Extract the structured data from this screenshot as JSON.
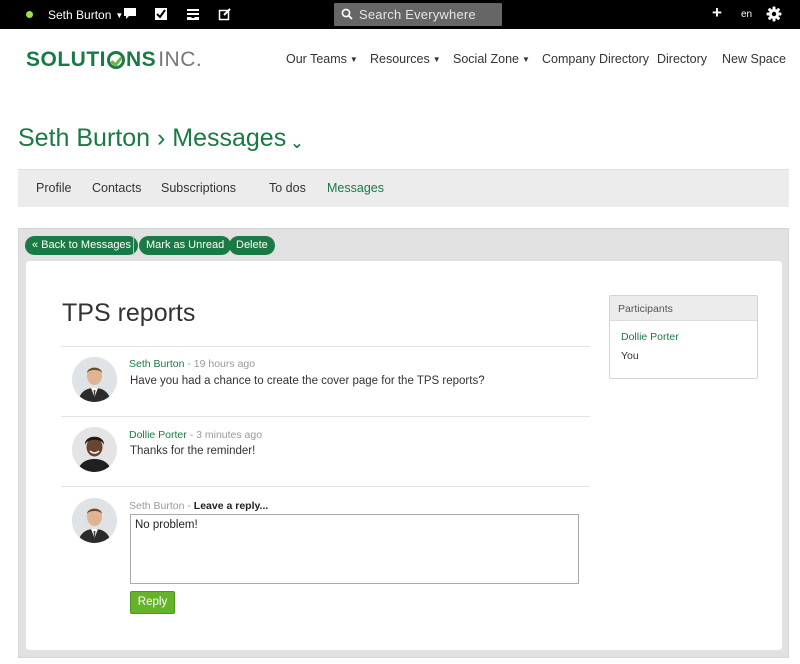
{
  "topbar": {
    "user_name": "Seth Burton",
    "search_placeholder": "Search Everywhere",
    "add_label": "+",
    "language": "en"
  },
  "logo": {
    "part1": "SOLUTI",
    "part2": "NS",
    "inc": "INC."
  },
  "main_nav": {
    "items": [
      {
        "label": "Our Teams",
        "dropdown": true
      },
      {
        "label": "Resources",
        "dropdown": true
      },
      {
        "label": "Social Zone",
        "dropdown": true
      },
      {
        "label": "Company Directory",
        "dropdown": false
      },
      {
        "label": "Directory",
        "dropdown": false
      },
      {
        "label": "New Space",
        "dropdown": false
      }
    ]
  },
  "breadcrumb": {
    "user": "Seth Burton",
    "separator": "›",
    "section": "Messages"
  },
  "sub_nav": {
    "tabs": [
      "Profile",
      "Contacts",
      "Subscriptions",
      "To dos",
      "Messages"
    ],
    "active": "Messages"
  },
  "actions": {
    "back": "« Back to Messages",
    "mark_unread": "Mark as Unread",
    "delete": "Delete"
  },
  "thread": {
    "title": "TPS reports",
    "messages": [
      {
        "author": "Seth Burton",
        "time": " - 19 hours ago",
        "body": "Have you had a chance to create the cover page for the TPS reports?"
      },
      {
        "author": "Dollie Porter",
        "time": " - 3 minutes ago",
        "body": "Thanks for the reminder!"
      }
    ],
    "reply": {
      "author": "Seth Burton",
      "separator": " - ",
      "prompt": "Leave a reply...",
      "value": "No problem!",
      "button": "Reply"
    }
  },
  "participants": {
    "heading": "Participants",
    "people": [
      "Dollie Porter",
      "You"
    ]
  },
  "colors": {
    "brand_green": "#1a7a45",
    "reply_button": "#64b329",
    "topbar": "#000000"
  }
}
